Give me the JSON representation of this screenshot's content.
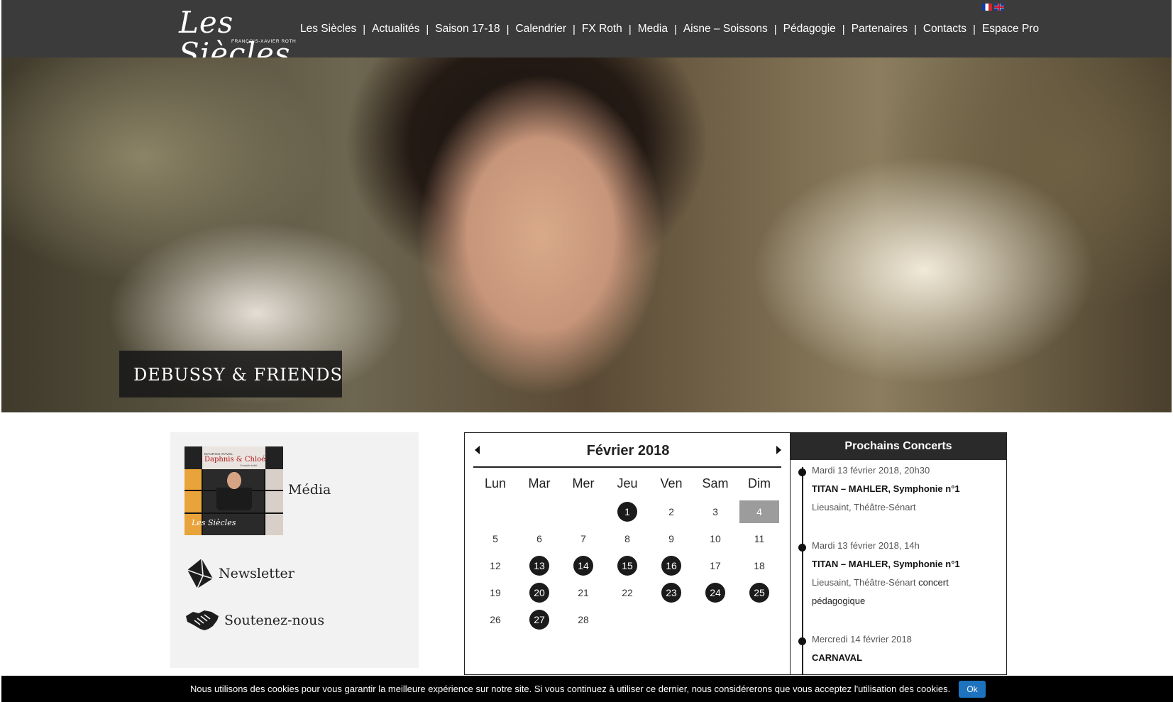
{
  "brand": {
    "logo_text": "Les Siècles",
    "logo_subtitle": "FRANÇOIS-XAVIER ROTH"
  },
  "nav": {
    "items": [
      {
        "label": "Les Siècles"
      },
      {
        "label": "Actualités"
      },
      {
        "label": "Saison 17-18"
      },
      {
        "label": "Calendrier"
      },
      {
        "label": "FX Roth"
      },
      {
        "label": "Media"
      },
      {
        "label": "Aisne – Soissons"
      },
      {
        "label": "Pédagogie"
      },
      {
        "label": "Partenaires"
      },
      {
        "label": "Contacts"
      },
      {
        "label": "Espace Pro"
      }
    ],
    "separator": "|"
  },
  "hero": {
    "caption": "DEBUSSY & FRIENDS"
  },
  "sidebar": {
    "media_cover": {
      "composer": "MAURICE RAVEL",
      "title": "Daphnis & Chloé",
      "subtitle": "Complete ballet",
      "signature": "Les Siècles"
    },
    "media_label": "Média",
    "newsletter_label": "Newsletter",
    "support_label": "Soutenez-nous"
  },
  "calendar": {
    "month_title": "Février 2018",
    "weekdays": [
      "Lun",
      "Mar",
      "Mer",
      "Jeu",
      "Ven",
      "Sam",
      "Dim"
    ],
    "days": [
      {
        "n": "1",
        "event": true
      },
      {
        "n": "2"
      },
      {
        "n": "3"
      },
      {
        "n": "4",
        "today": true
      },
      {
        "n": "5"
      },
      {
        "n": "6"
      },
      {
        "n": "7"
      },
      {
        "n": "8"
      },
      {
        "n": "9"
      },
      {
        "n": "10"
      },
      {
        "n": "11"
      },
      {
        "n": "12"
      },
      {
        "n": "13",
        "event": true
      },
      {
        "n": "14",
        "event": true
      },
      {
        "n": "15",
        "event": true
      },
      {
        "n": "16",
        "event": true
      },
      {
        "n": "17"
      },
      {
        "n": "18"
      },
      {
        "n": "19"
      },
      {
        "n": "20",
        "event": true
      },
      {
        "n": "21"
      },
      {
        "n": "22"
      },
      {
        "n": "23",
        "event": true
      },
      {
        "n": "24",
        "event": true
      },
      {
        "n": "25",
        "event": true
      },
      {
        "n": "26"
      },
      {
        "n": "27",
        "event": true
      },
      {
        "n": "28"
      }
    ]
  },
  "concerts": {
    "heading": "Prochains Concerts",
    "events": [
      {
        "date": "Mardi 13 février 2018, 20h30",
        "title": "TITAN – MAHLER, Symphonie n°1",
        "venue": "Lieusaint, Théâtre-Sénart",
        "extra": ""
      },
      {
        "date": "Mardi 13 février 2018, 14h",
        "title": "TITAN – MAHLER, Symphonie n°1",
        "venue": "Lieusaint, Théâtre-Sénart",
        "extra": "concert pédagogique"
      },
      {
        "date": "Mercredi 14 février 2018",
        "title": "CARNAVAL",
        "venue": "",
        "extra": ""
      }
    ]
  },
  "cookie": {
    "text": "Nous utilisons des cookies pour vous garantir la meilleure expérience sur notre site. Si vous continuez à utiliser ce dernier, nous considérerons que vous acceptez l'utilisation des cookies.",
    "button_label": "Ok"
  }
}
